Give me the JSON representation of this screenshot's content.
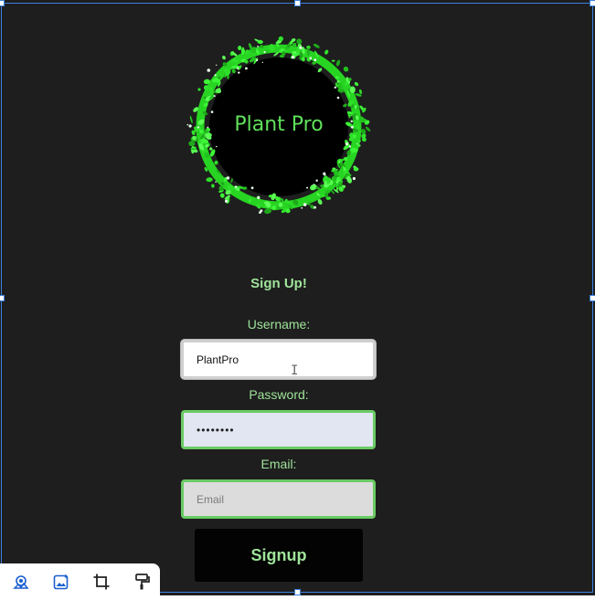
{
  "logo": {
    "text": "Plant Pro"
  },
  "form": {
    "heading": "Sign Up!",
    "username_label": "Username:",
    "username_value": "PlantPro",
    "password_label": "Password:",
    "password_value": "••••••••",
    "email_label": "Email:",
    "email_placeholder": "Email",
    "submit_label": "Signup"
  },
  "colors": {
    "background": "#1e1e1e",
    "accent_green": "#9fe49a",
    "wreath_green": "#33e62e",
    "selection_blue": "#3b7fe0"
  },
  "toolbar": {
    "icons": [
      "image-adjust-icon",
      "image-ai-icon",
      "crop-icon",
      "format-paint-icon"
    ]
  }
}
